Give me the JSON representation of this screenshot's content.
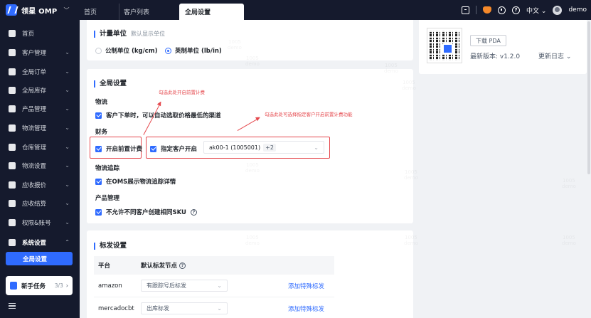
{
  "topbar": {
    "brand": "领星 OMP",
    "tabs": [
      "首页",
      "客户列表",
      "全局设置"
    ],
    "language": "中文",
    "user": "demo"
  },
  "sidebar": {
    "items": [
      {
        "label": "首页",
        "icon": "home-icon",
        "caret": false
      },
      {
        "label": "客户管理",
        "icon": "customers-icon",
        "caret": true
      },
      {
        "label": "全局订单",
        "icon": "orders-icon",
        "caret": true
      },
      {
        "label": "全局库存",
        "icon": "inventory-icon",
        "caret": true
      },
      {
        "label": "产品管理",
        "icon": "product-icon",
        "caret": true
      },
      {
        "label": "物流管理",
        "icon": "truck-icon",
        "caret": true
      },
      {
        "label": "仓库管理",
        "icon": "warehouse-icon",
        "caret": true
      },
      {
        "label": "物流设置",
        "icon": "logistics-settings-icon",
        "caret": true
      },
      {
        "label": "应收报价",
        "icon": "quote-icon",
        "caret": true
      },
      {
        "label": "应收结算",
        "icon": "settlement-icon",
        "caret": true
      },
      {
        "label": "权限&账号",
        "icon": "permission-icon",
        "caret": true
      },
      {
        "label": "系统设置",
        "icon": "settings-icon",
        "caret": true
      }
    ],
    "active_sub": "全局设置",
    "task": {
      "label": "新手任务",
      "count": "3/3"
    }
  },
  "unit": {
    "title": "计量单位",
    "subtitle": "默认显示单位",
    "options": [
      "公制单位 (kg/cm)",
      "英制单位 (lb/in)"
    ],
    "selected": 1
  },
  "global": {
    "title": "全局设置",
    "logistics_label": "物流",
    "logistics_option": "客户下单时，可以自动选取价格最低的渠道",
    "finance_label": "财务",
    "prepay_option": "开启前置计费",
    "customer_option": "指定客户开启",
    "customer_select": "ak00-1 (1005001)",
    "customer_more": "+2",
    "tracking_label": "物流追踪",
    "tracking_option": "在OMS展示物流追踪详情",
    "product_label": "产品管理",
    "product_option": "不允许不同客户创建相同SKU",
    "annotation_1": "勾选此处开启前置计费",
    "annotation_2": "勾选此处可选择指定客户开启前置计费功能"
  },
  "labeling": {
    "title": "标发设置",
    "headers": [
      "平台",
      "默认标发节点"
    ],
    "rows": [
      {
        "platform": "amazon",
        "node": "有跟踪号后标发",
        "action": "添加特殊标发"
      },
      {
        "platform": "mercadocbt",
        "node": "出库标发",
        "action": "添加特殊标发"
      }
    ]
  },
  "pda": {
    "download": "下载 PDA",
    "version": "最新版本: v1.2.0",
    "changelog": "更新日志"
  },
  "watermark": {
    "line1": "1005",
    "line2": "demo"
  },
  "colors": {
    "accent": "#2f6bff",
    "sidebar_bg": "#151a2d",
    "annotation": "#e5484d"
  }
}
